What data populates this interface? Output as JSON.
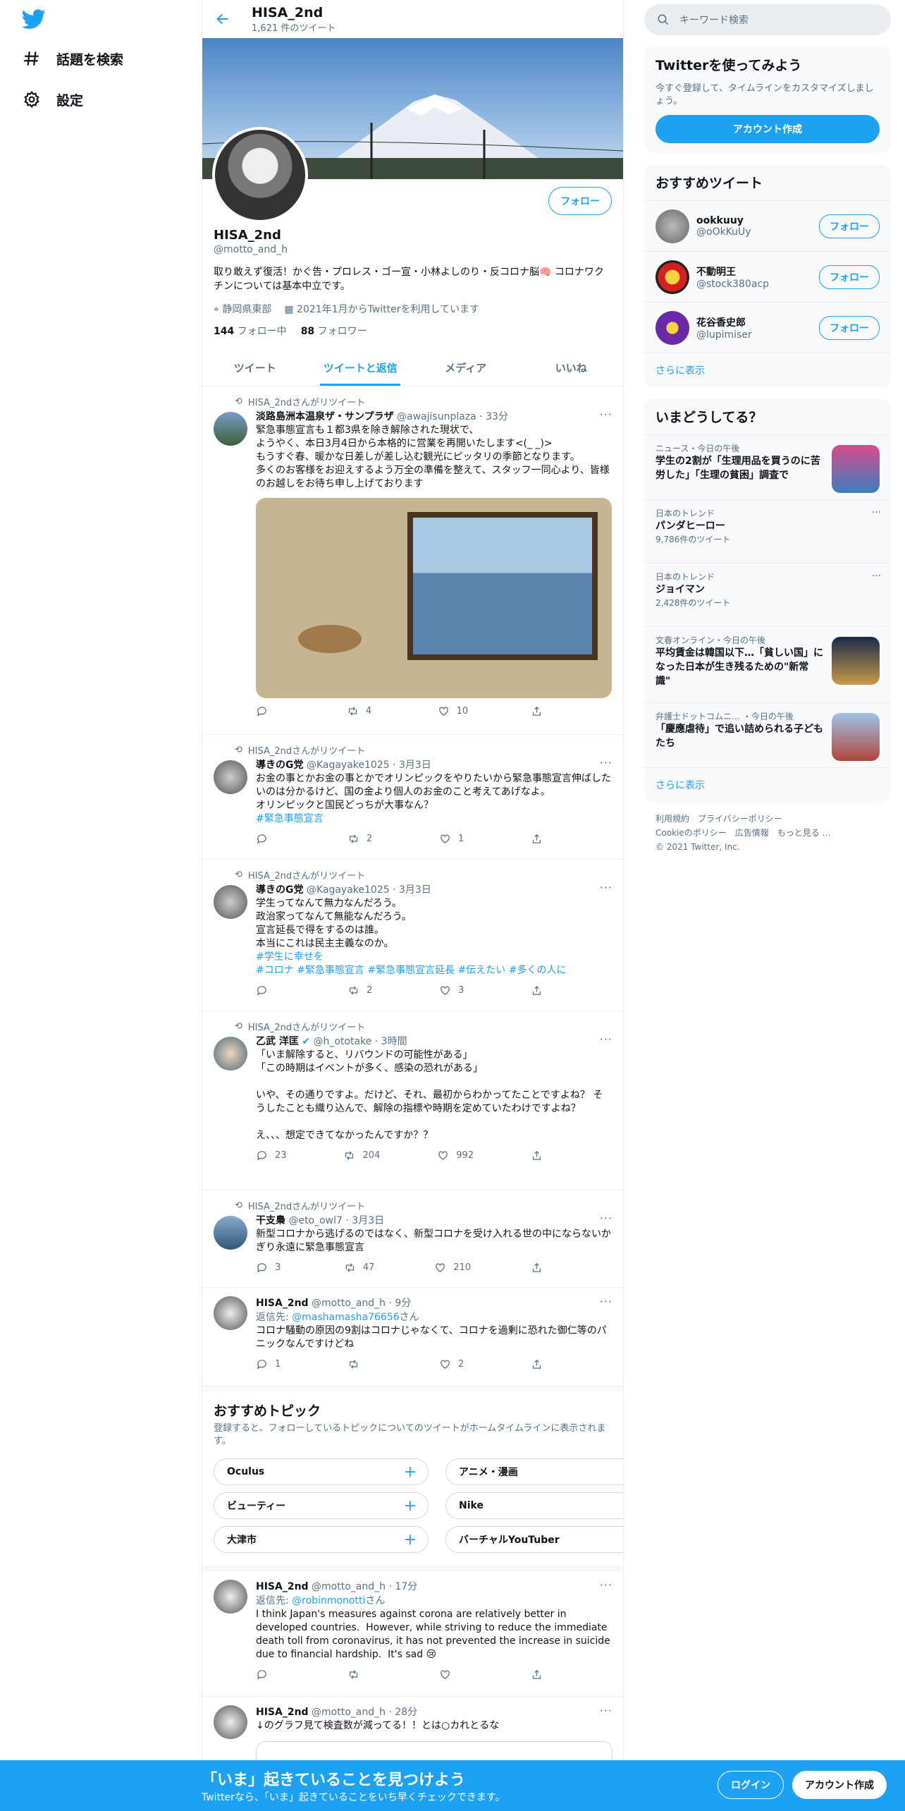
{
  "nav": {
    "explore": "話題を検索",
    "settings": "設定"
  },
  "header": {
    "title": "HISA_2nd",
    "count": "1,621 件のツイート"
  },
  "profile": {
    "name": "HISA_2nd",
    "handle": "@motto_and_h",
    "follow": "フォロー",
    "bio": "取り敢えず復活！かぐ告・プロレス・ゴー宣・小林よしのり・反コロナ脳🧠 コロナワクチンについては基本中立です。",
    "location": "静岡県東部",
    "joined": "2021年1月からTwitterを利用しています",
    "following_num": "144",
    "following_label": "フォロー中",
    "followers_num": "88",
    "followers_label": "フォロワー"
  },
  "tabs": [
    "ツイート",
    "ツイートと返信",
    "メディア",
    "いいね"
  ],
  "tweets": [
    {
      "rt": "HISA_2ndさんがリツイート",
      "name": "淡路島洲本温泉ザ・サンプラザ",
      "handle": "@awajisunplaza",
      "time": "33分",
      "body": "緊急事態宣言も１都3県を除き解除された現状で、\nようやく、本日3月4日から本格的に営業を再開いたします<(_ _)>\nもうすぐ春、暖かな日差しが差し込む観光にピッタリの季節となります。\n多くのお客様をお迎えするよう万全の準備を整えて、スタッフ一同心より、皆様のお越しをお待ち申し上げております",
      "reply": "",
      "retweet": "4",
      "like": "10"
    },
    {
      "rt": "HISA_2ndさんがリツイート",
      "name": "導きのG党",
      "handle": "@Kagayake1025",
      "time": "3月3日",
      "body": "お金の事とかお金の事とかでオリンピックをやりたいから緊急事態宣言伸ばしたいのは分かるけど、国の金より個人のお金のこと考えてあげなよ。\nオリンピックと国民どっちが大事なん？",
      "tags": "#緊急事態宣言",
      "reply": "",
      "retweet": "2",
      "like": "1"
    },
    {
      "rt": "HISA_2ndさんがリツイート",
      "name": "導きのG党",
      "handle": "@Kagayake1025",
      "time": "3月3日",
      "body": "学生ってなんて無力なんだろう。\n政治家ってなんて無能なんだろう。\n宣言延長で得をするのは誰。\n本当にこれは民主主義なのか。",
      "tags": "#学生に幸せを\n#コロナ #緊急事態宣言 #緊急事態宣言延長 #伝えたい #多くの人に",
      "reply": "",
      "retweet": "2",
      "like": "3"
    },
    {
      "rt": "HISA_2ndさんがリツイート",
      "name": "乙武 洋匡",
      "handle": "@h_ototake",
      "time": "3時間",
      "body": "「いま解除すると、リバウンドの可能性がある」\n「この時期はイベントが多く、感染の恐れがある」\n\nいや、その通りですよ。だけど、それ、最初からわかってたことですよね？ そうしたことも織り込んで、解除の指標や時期を定めていたわけですよね？\n\nえ、、、想定できてなかったんですか？？",
      "reply": "23",
      "retweet": "204",
      "like": "992"
    },
    {
      "rt": "HISA_2ndさんがリツイート",
      "name": "干支梟",
      "handle": "@eto_owl7",
      "time": "3月3日",
      "body": "新型コロナから逃げるのではなく、新型コロナを受け入れる世の中にならないかぎり永遠に緊急事態宣言",
      "reply": "3",
      "retweet": "47",
      "like": "210"
    },
    {
      "name": "HISA_2nd",
      "handle": "@motto_and_h",
      "time": "9分",
      "reply_prefix": "返信先: ",
      "reply_to": "@mashamasha76656",
      "reply_suffix": "さん",
      "body": "コロナ騒動の原因の9割はコロナじゃなくて、コロナを過剰に恐れた御仁等のパニックなんですけどね",
      "reply": "1",
      "retweet": "",
      "like": "2"
    }
  ],
  "topics": {
    "title": "おすすめトピック",
    "desc": "登録すると、フォローしているトピックについてのツイートがホームタイムラインに表示されます。",
    "items": [
      "Oculus",
      "アニメ・漫画",
      "ビューティー",
      "Nike",
      "大津市",
      "バーチャルYouTuber"
    ]
  },
  "tweets2": [
    {
      "name": "HISA_2nd",
      "handle": "@motto_and_h",
      "time": "17分",
      "reply_prefix": "返信先: ",
      "reply_to": "@robinmonotti",
      "reply_suffix": "さん",
      "body": "I think Japan's measures against corona are relatively better in developed countries.  However, while striving to reduce the immediate death toll from coronavirus, it has not prevented the increase in suicide due to financial hardship.  It's sad 😢"
    },
    {
      "name": "HISA_2nd",
      "handle": "@motto_and_h",
      "time": "28分",
      "body": "↓のグラフ見て検査数が減ってる！！とは○カれとるな"
    }
  ],
  "right": {
    "search_placeholder": "キーワード検索",
    "promo_title": "Twitterを使ってみよう",
    "promo_text": "今すぐ登録して、タイムラインをカスタマイズしましょう。",
    "promo_btn": "アカウント作成",
    "rec_title": "おすすめツイート",
    "recs": [
      {
        "name": "ookkuuy",
        "handle": "@oOkKuUy"
      },
      {
        "name": "不動明王",
        "handle": "@stock380acp"
      },
      {
        "name": "花谷香史郎",
        "handle": "@lupimiser"
      }
    ],
    "rec_btn": "フォロー",
    "more": "さらに表示",
    "trend_title": "いまどうしてる？",
    "trends": [
      {
        "ctx": "ニュース・今日の午後",
        "title": "学生の2割が「生理用品を買うのに苦労した」「生理の貧困」調査で"
      },
      {
        "ctx": "日本のトレンド",
        "title": "パンダヒーロー",
        "cnt": "9,786件のツイート"
      },
      {
        "ctx": "日本のトレンド",
        "title": "ジョイマン",
        "cnt": "2,428件のツイート"
      },
      {
        "ctx": "文春オンライン・今日の午後",
        "title": "平均賃金は韓国以下…「貧しい国」になった日本が生き残るための\"新常識\""
      },
      {
        "ctx": "弁護士ドットコムニ… ・今日の午後",
        "title": "「慶應虐待」で追い詰められる子どもたち"
      }
    ],
    "footer": [
      "利用規約",
      "プライバシーポリシー",
      "Cookieのポリシー",
      "広告情報",
      "もっと見る …",
      "© 2021 Twitter, Inc."
    ]
  },
  "bottom": {
    "title": "「いま」起きていることを見つけよう",
    "sub": "Twitterなら、「いま」起きていることをいち早くチェックできます。",
    "login": "ログイン",
    "signup": "アカウント作成"
  }
}
